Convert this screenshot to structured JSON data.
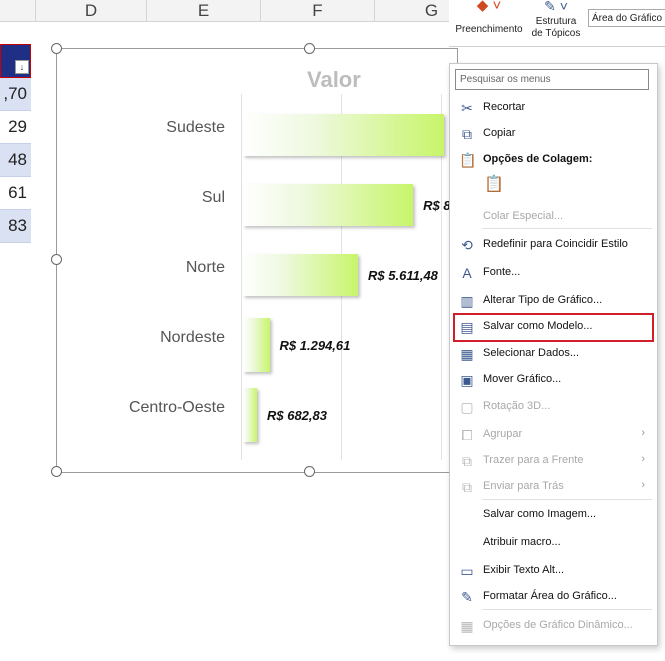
{
  "columns": [
    "D",
    "E",
    "F",
    "G"
  ],
  "left_cells": [
    ",70",
    "29",
    "48",
    "61",
    "83"
  ],
  "ribbon": {
    "fill_label": "Preenchimento",
    "outline_label_1": "Estrutura",
    "outline_label_2": "de Tópicos",
    "select_value": "Área do Gráfico"
  },
  "chart": {
    "title": "Valor"
  },
  "chart_data": {
    "type": "bar",
    "orientation": "horizontal",
    "title": "Valor",
    "categories": [
      "Sudeste",
      "Sul",
      "Norte",
      "Nordeste",
      "Centro-Oeste"
    ],
    "values": [
      9800,
      8300,
      5611.48,
      1294.61,
      682.83
    ],
    "labels": [
      "",
      "R$ 8.",
      "R$ 5.611,48",
      "R$ 1.294,61",
      "R$ 682,83"
    ],
    "xlim": [
      0,
      12000
    ],
    "grid": true,
    "legend": "none",
    "colors": {
      "bar_start": "#ffffff",
      "bar_end": "#c8f56a"
    }
  },
  "menu": {
    "search_placeholder": "Pesquisar os menus",
    "items": [
      {
        "label": "Recortar",
        "icon": "scissors-icon",
        "glyph": "✂",
        "disabled": false
      },
      {
        "label": "Copiar",
        "icon": "copy-icon",
        "glyph": "⧉",
        "disabled": false
      },
      {
        "label": "Opções de Colagem:",
        "icon": "paste-icon",
        "glyph": "📋",
        "disabled": false,
        "bold": true
      },
      {
        "label": "Colar Especial...",
        "icon": "",
        "glyph": "",
        "disabled": true
      },
      {
        "label": "Redefinir para Coincidir Estilo",
        "icon": "reset-style-icon",
        "glyph": "⟲",
        "disabled": false
      },
      {
        "label": "Fonte...",
        "icon": "font-icon",
        "glyph": "A",
        "disabled": false
      },
      {
        "label": "Alterar Tipo de Gráfico...",
        "icon": "chart-type-icon",
        "glyph": "▥",
        "disabled": false
      },
      {
        "label": "Salvar como Modelo...",
        "icon": "save-template-icon",
        "glyph": "▤",
        "disabled": false
      },
      {
        "label": "Selecionar Dados...",
        "icon": "select-data-icon",
        "glyph": "▦",
        "disabled": false
      },
      {
        "label": "Mover Gráfico...",
        "icon": "move-chart-icon",
        "glyph": "▣",
        "disabled": false
      },
      {
        "label": "Rotação 3D...",
        "icon": "rotate-3d-icon",
        "glyph": "▢",
        "disabled": true
      },
      {
        "label": "Agrupar",
        "icon": "group-icon",
        "glyph": "⧠",
        "disabled": true,
        "submenu": true
      },
      {
        "label": "Trazer para a Frente",
        "icon": "bring-front-icon",
        "glyph": "⧉",
        "disabled": true,
        "submenu": true
      },
      {
        "label": "Enviar para Trás",
        "icon": "send-back-icon",
        "glyph": "⧉",
        "disabled": true,
        "submenu": true
      },
      {
        "label": "Salvar como Imagem...",
        "icon": "",
        "glyph": "",
        "disabled": false
      },
      {
        "label": "Atribuir macro...",
        "icon": "",
        "glyph": "",
        "disabled": false
      },
      {
        "label": "Exibir Texto Alt...",
        "icon": "alt-text-icon",
        "glyph": "▭",
        "disabled": false
      },
      {
        "label": "Formatar Área do Gráfico...",
        "icon": "format-area-icon",
        "glyph": "✎",
        "disabled": false
      },
      {
        "label": "Opções de Gráfico Dinâmico...",
        "icon": "pivot-chart-icon",
        "glyph": "▦",
        "disabled": true
      }
    ]
  }
}
